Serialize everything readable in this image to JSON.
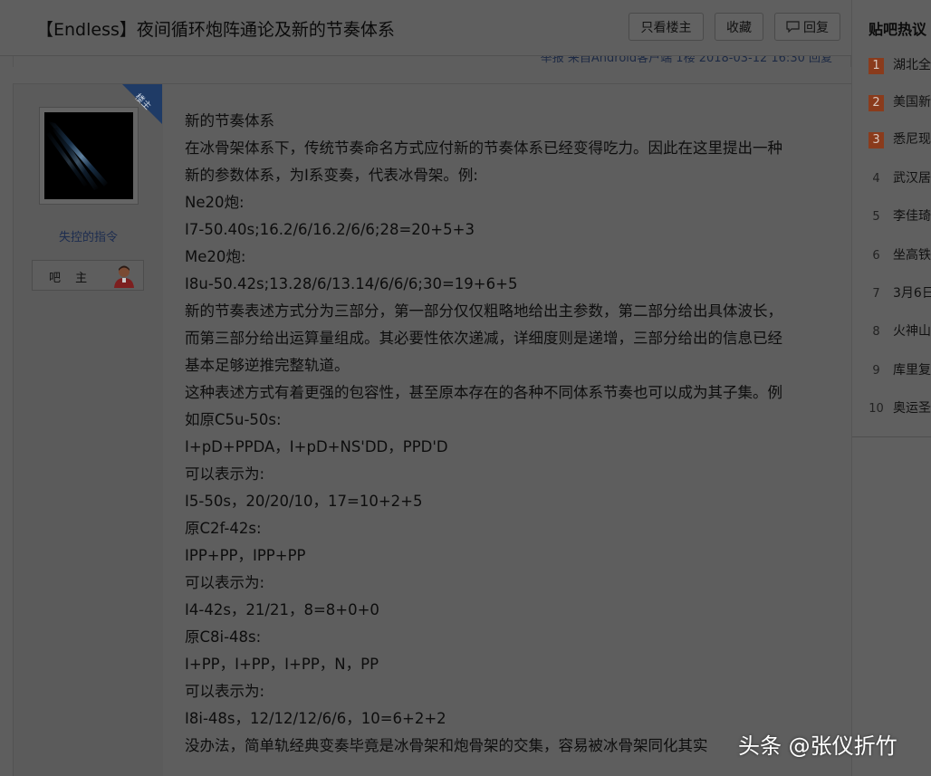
{
  "thread": {
    "title": "【Endless】夜间循环炮阵通论及新的节奏体系",
    "buttons": {
      "only_op": "只看楼主",
      "favorite": "收藏",
      "reply": "回复"
    },
    "meta_line": "举报  来自Android客户端  1楼  2018-03-12 16:30  回复"
  },
  "author": {
    "badge": "楼主",
    "name": "失控的指令",
    "role": "吧 主"
  },
  "post": {
    "lines": [
      "新的节奏体系",
      "在冰骨架体系下，传统节奏命名方式应付新的节奏体系已经变得吃力。因此在这里提出一种",
      "新的参数体系，为I系变奏，代表冰骨架。例:",
      "Ne20炮:",
      "I7-50.40s;16.2/6/16.2/6/6;28=20+5+3",
      "Me20炮:",
      "I8u-50.42s;13.28/6/13.14/6/6/6;30=19+6+5",
      "新的节奏表述方式分为三部分，第一部分仅仅粗略地给出主参数，第二部分给出具体波长，",
      "而第三部分给出运算量组成。其必要性依次递减，详细度则是递增，三部分给出的信息已经",
      "基本足够逆推完整轨道。",
      "这种表述方式有着更强的包容性，甚至原本存在的各种不同体系节奏也可以成为其子集。例",
      "如原C5u-50s:",
      "I+pD+PPDA，I+pD+NS'DD，PPD'D",
      "可以表示为:",
      "I5-50s，20/20/10，17=10+2+5",
      "原C2f-42s:",
      "IPP+PP，IPP+PP",
      "可以表示为:",
      "I4-42s，21/21，8=8+0+0",
      "原C8i-48s:",
      "I+PP，I+PP，I+PP，N，PP",
      "可以表示为:",
      "I8i-48s，12/12/12/6/6，10=6+2+2",
      "没办法，简单轨经典变奏毕竟是冰骨架和炮骨架的交集，容易被冰骨架同化其实"
    ]
  },
  "sidebar": {
    "title": "贴吧热议",
    "items": [
      {
        "rank": "1",
        "text": "湖北全"
      },
      {
        "rank": "2",
        "text": "美国新"
      },
      {
        "rank": "3",
        "text": "悉尼现"
      },
      {
        "rank": "4",
        "text": "武汉居"
      },
      {
        "rank": "5",
        "text": "李佳琦"
      },
      {
        "rank": "6",
        "text": "坐高铁"
      },
      {
        "rank": "7",
        "text": "3月6日"
      },
      {
        "rank": "8",
        "text": "火神山"
      },
      {
        "rank": "9",
        "text": "库里复"
      },
      {
        "rank": "10",
        "text": "奥运圣"
      }
    ]
  },
  "watermark": "头条 @张仪折竹",
  "icons": {
    "reply": "speech-bubble-icon",
    "role": "user-avatar-icon"
  },
  "colors": {
    "overlay_bg": "#5e5e5e",
    "hot_rank": "#8a3b1c",
    "author_link": "#1c2c4f",
    "badge": "#1f3b66"
  }
}
